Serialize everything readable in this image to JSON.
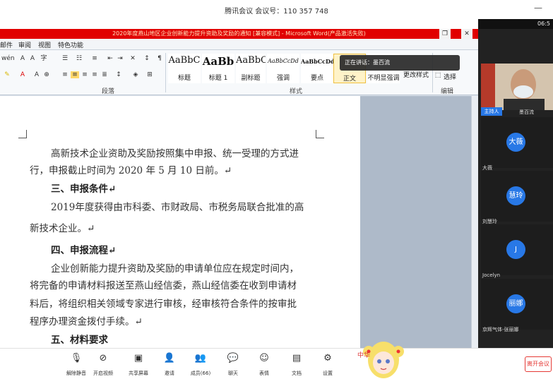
{
  "meeting": {
    "title": "腾讯会议 会议号：110 357 748",
    "time": "06:5"
  },
  "word": {
    "title": "2020年度燕山地区企业创新能力提升资助及奖励的通知 [兼容模式] - Microsoft Word(产品激活失败)",
    "menus": [
      "邮件",
      "审阅",
      "视图",
      "特色功能"
    ],
    "groups": {
      "paragraph": "段落",
      "styles": "样式",
      "edit": "编辑"
    },
    "styles": [
      {
        "sample": "AaBbC",
        "name": "标题"
      },
      {
        "sample": "AaBb",
        "name": "标题 1"
      },
      {
        "sample": "AaBbC",
        "name": "副标题"
      },
      {
        "sample": "AaBbCcDd",
        "name": "强调"
      },
      {
        "sample": "AaBbCcDd",
        "name": "要点"
      }
    ],
    "extra_styles": {
      "normal": "正文",
      "subtle": "不明显强调",
      "change": "更改样式"
    },
    "select_label": "选择",
    "document": [
      {
        "text": "高新技术企业资助及奖励按照集中申报、统一受理的方式进",
        "type": "body"
      },
      {
        "text": "行，申报截止时间为 2020 年 5 月 10 日前。↵",
        "type": "body"
      },
      {
        "text": "三、申报条件↵",
        "type": "head"
      },
      {
        "text": "2019年度获得由市科委、市财政局、市税务局联合批准的高",
        "type": "body"
      },
      {
        "text": "新技术企业。↵",
        "type": "body"
      },
      {
        "text": "四、申报流程↵",
        "type": "head"
      },
      {
        "text": "企业创新能力提升资助及奖励的申请单位应在规定时间内，",
        "type": "body"
      },
      {
        "text": "将完备的申请材料报送至燕山经信委，燕山经信委在收到申请材",
        "type": "body"
      },
      {
        "text": "料后，将组织相关领域专家进行审核，经审核符合条件的按审批",
        "type": "body"
      },
      {
        "text": "程序办理资金拨付手续。↵",
        "type": "body"
      },
      {
        "text": "五、材料要求",
        "type": "head"
      }
    ]
  },
  "speaking": {
    "label": "正在讲话：",
    "name": "墨百流"
  },
  "participants": {
    "host_tag": "主持人",
    "self_name": "墨百流",
    "tiles": [
      {
        "initial": "大薇",
        "name": "大薇"
      },
      {
        "initial": "慧玲",
        "name": "刘慧玲"
      },
      {
        "initial": "J",
        "name": "Jocelyn"
      },
      {
        "initial": "丽娜",
        "name": "京辉气体-张丽娜"
      }
    ]
  },
  "toolbar": {
    "buttons": [
      {
        "label": "解除静音",
        "icon": "mic-muted-icon"
      },
      {
        "label": "开启视频",
        "icon": "camera-off-icon"
      },
      {
        "label": "共享屏幕",
        "icon": "screen-share-icon"
      },
      {
        "label": "邀请",
        "icon": "invite-icon"
      },
      {
        "label": "成员(66)",
        "icon": "members-icon"
      },
      {
        "label": "聊天",
        "icon": "chat-icon"
      },
      {
        "label": "表情",
        "icon": "emoji-icon"
      },
      {
        "label": "文档",
        "icon": "document-icon"
      },
      {
        "label": "设置",
        "icon": "settings-icon"
      }
    ],
    "leave": "离开会议"
  },
  "sticker": {
    "text": "中华"
  }
}
